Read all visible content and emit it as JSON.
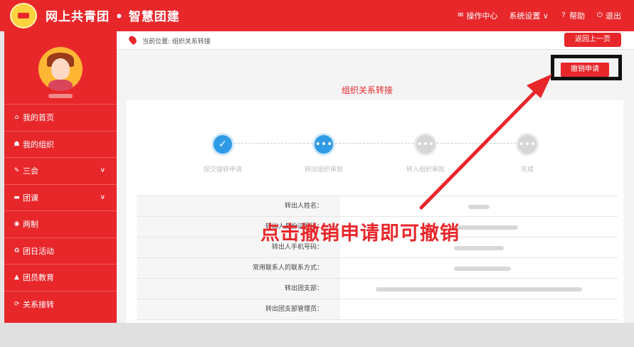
{
  "header": {
    "brand_main": "网上共青团",
    "brand_sub": "• 智慧团建",
    "nav": [
      {
        "icon": "mail-icon",
        "glyph": "✉",
        "label": "操作中心"
      },
      {
        "icon": "settings-icon",
        "glyph": "",
        "label": "系统设置 ∨"
      },
      {
        "icon": "help-icon",
        "glyph": "?",
        "label": "帮助"
      },
      {
        "icon": "power-icon",
        "glyph": "⏻",
        "label": "退出"
      }
    ]
  },
  "sidebar": {
    "items": [
      {
        "label": "我的首页",
        "icon": "home-icon",
        "glyph": "⌂",
        "has_chevron": false
      },
      {
        "label": "我的组织",
        "icon": "group-icon",
        "glyph": "☗",
        "has_chevron": false
      },
      {
        "label": "三会",
        "icon": "edit-icon",
        "glyph": "✎",
        "has_chevron": true
      },
      {
        "label": "团课",
        "icon": "folder-icon",
        "glyph": "▬",
        "has_chevron": true
      },
      {
        "label": "两制",
        "icon": "circle-icon",
        "glyph": "◉",
        "has_chevron": false
      },
      {
        "label": "团日活动",
        "icon": "recycle-icon",
        "glyph": "♻",
        "has_chevron": false
      },
      {
        "label": "团员教育",
        "icon": "graduation-icon",
        "glyph": "▲",
        "has_chevron": false
      },
      {
        "label": "关系接转",
        "icon": "refresh-icon",
        "glyph": "⟳",
        "has_chevron": false
      }
    ]
  },
  "breadcrumb": "当前位置: 组织关系转接",
  "buttons": {
    "back": "返回上一页",
    "cancel": "撤销申请"
  },
  "page_title": "组织关系转接",
  "steps": [
    {
      "label": "提交接转申请",
      "state": "done",
      "glyph": "✓"
    },
    {
      "label": "转出组织审批",
      "state": "current",
      "glyph": "•••"
    },
    {
      "label": "转入组织审批",
      "state": "pending",
      "glyph": "•••"
    },
    {
      "label": "完成",
      "state": "pending",
      "glyph": "•••"
    }
  ],
  "info_rows": [
    {
      "key": "转出人姓名："
    },
    {
      "key": "转出人身份证号码："
    },
    {
      "key": "转出人手机号码："
    },
    {
      "key": "常用联系人的联系方式："
    },
    {
      "key": "转出团支部："
    },
    {
      "key": "转出团支部管理员："
    }
  ],
  "annotation": "点击撤销申请即可撤销",
  "colors": {
    "brand_red": "#e8272b",
    "step_blue": "#2f9be6",
    "highlight_black": "#111111"
  }
}
